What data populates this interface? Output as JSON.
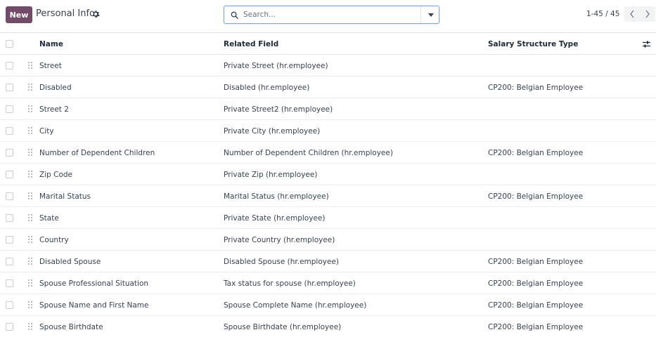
{
  "toolbar": {
    "new_label": "New",
    "title": "Personal Info",
    "search_placeholder": "Search...",
    "pager": "1-45 / 45"
  },
  "table": {
    "headers": {
      "name": "Name",
      "related_field": "Related Field",
      "salary_structure_type": "Salary Structure Type"
    },
    "rows": [
      {
        "name": "Street",
        "related": "Private Street (hr.employee)",
        "salary": ""
      },
      {
        "name": "Disabled",
        "related": "Disabled (hr.employee)",
        "salary": "CP200: Belgian Employee"
      },
      {
        "name": "Street 2",
        "related": "Private Street2 (hr.employee)",
        "salary": ""
      },
      {
        "name": "City",
        "related": "Private City (hr.employee)",
        "salary": ""
      },
      {
        "name": "Number of Dependent Children",
        "related": "Number of Dependent Children (hr.employee)",
        "salary": "CP200: Belgian Employee"
      },
      {
        "name": "Zip Code",
        "related": "Private Zip (hr.employee)",
        "salary": ""
      },
      {
        "name": "Marital Status",
        "related": "Marital Status (hr.employee)",
        "salary": "CP200: Belgian Employee"
      },
      {
        "name": "State",
        "related": "Private State (hr.employee)",
        "salary": ""
      },
      {
        "name": "Country",
        "related": "Private Country (hr.employee)",
        "salary": ""
      },
      {
        "name": "Disabled Spouse",
        "related": "Disabled Spouse (hr.employee)",
        "salary": "CP200: Belgian Employee"
      },
      {
        "name": "Spouse Professional Situation",
        "related": "Tax status for spouse (hr.employee)",
        "salary": "CP200: Belgian Employee"
      },
      {
        "name": "Spouse Name and First Name",
        "related": "Spouse Complete Name (hr.employee)",
        "salary": "CP200: Belgian Employee"
      },
      {
        "name": "Spouse Birthdate",
        "related": "Spouse Birthdate (hr.employee)",
        "salary": "CP200: Belgian Employee"
      }
    ]
  },
  "icons": [
    "gear-icon",
    "search-icon",
    "chevron-down-icon",
    "chevron-left-icon",
    "chevron-right-icon",
    "optional-columns-icon",
    "drag-handle-icon"
  ],
  "colors": {
    "brand": "#714b67",
    "search_border": "#7aa7d6"
  }
}
